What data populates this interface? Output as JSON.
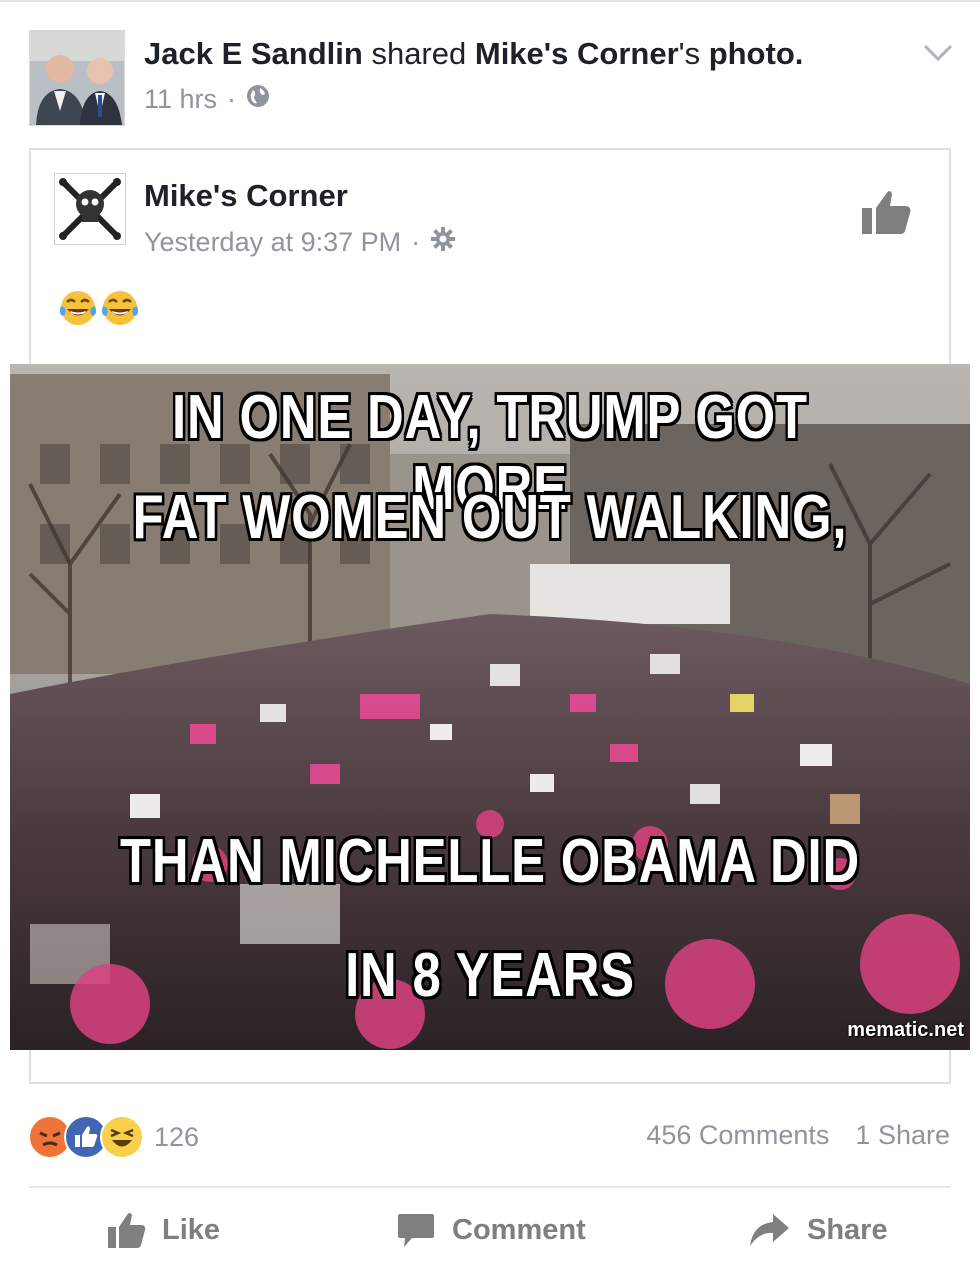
{
  "post": {
    "author": "Jack E Sandlin",
    "action_text": "shared",
    "shared_from": "Mike's Corner",
    "shared_suffix": "'s photo.",
    "time": "11 hrs",
    "separator": "·",
    "privacy_icon": "globe-icon"
  },
  "shared_post": {
    "page_name": "Mike's Corner",
    "timestamp": "Yesterday at 9:37 PM",
    "separator": "·",
    "settings_icon": "gear-icon",
    "emoji_text": [
      "😂",
      "😂"
    ]
  },
  "meme": {
    "lines_top": [
      "IN ONE DAY, TRUMP GOT MORE",
      "FAT WOMEN OUT WALKING,"
    ],
    "lines_bottom": [
      "THAN MICHELLE OBAMA DID",
      "IN 8 YEARS"
    ],
    "watermark": "mematic.net"
  },
  "engagement": {
    "reaction_icons": [
      "angry-icon",
      "like-icon",
      "haha-icon"
    ],
    "reaction_count": "126",
    "comments": "456 Comments",
    "shares": "1 Share"
  },
  "actions": {
    "like": "Like",
    "comment": "Comment",
    "share": "Share"
  },
  "colors": {
    "meta_gray": "#90949c",
    "like_blue": "#4267b2",
    "angry_orange": "#f0743a",
    "haha_yellow": "#f8d04a",
    "action_gray": "#7f7f7f"
  }
}
